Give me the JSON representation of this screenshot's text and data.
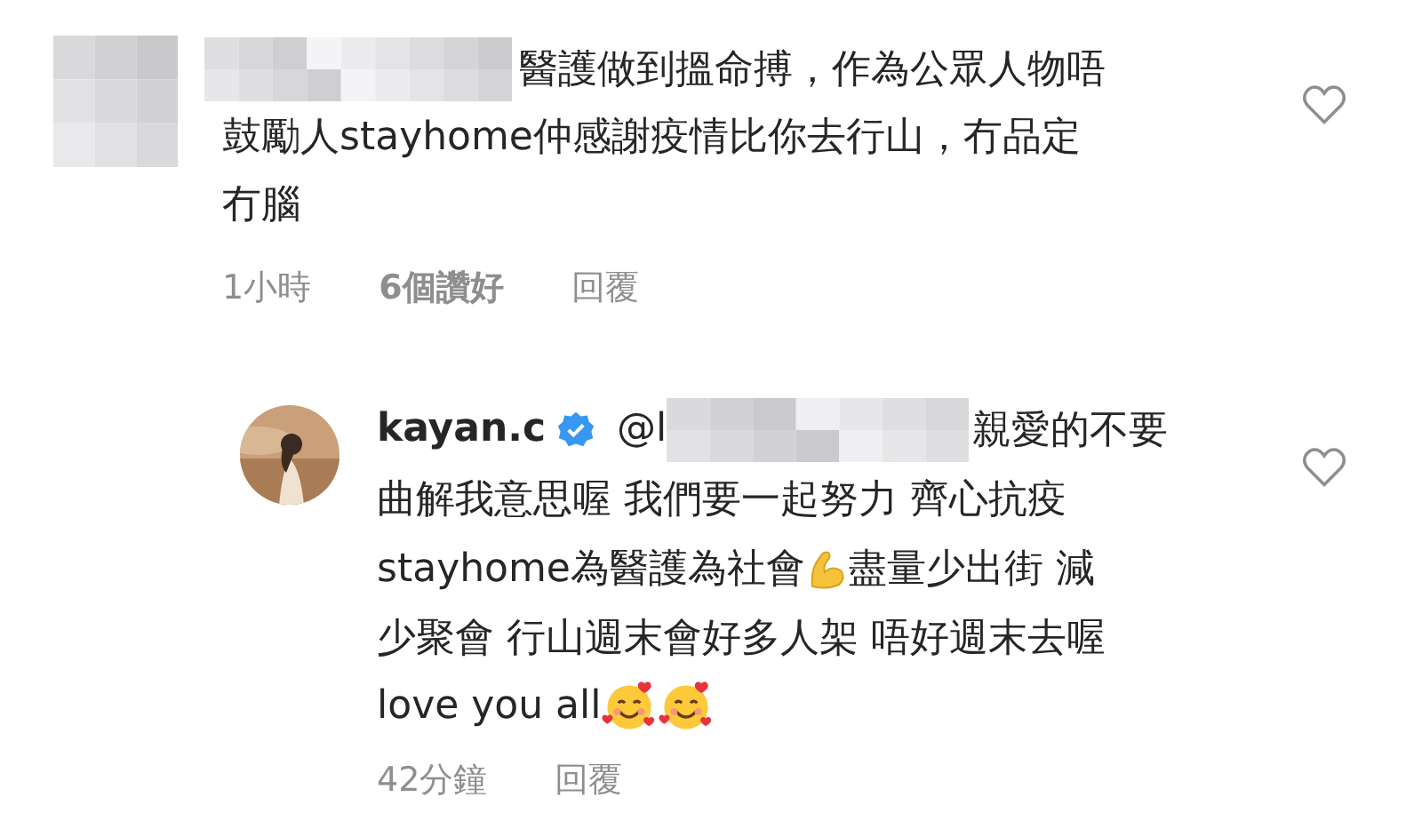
{
  "comments": [
    {
      "is_reply": false,
      "avatar": {
        "kind": "blurred"
      },
      "username": {
        "kind": "blurred"
      },
      "liked": false,
      "lines": [
        [
          {
            "kind": "text",
            "text": "醫護做到搵命搏，作為公眾人物唔"
          }
        ],
        [
          {
            "kind": "text",
            "text": "鼓勵人stayhome仲感謝疫情比你去行山，冇品定"
          }
        ],
        [
          {
            "kind": "text",
            "text": "冇腦"
          }
        ]
      ],
      "time": "1小時",
      "likes": "6個讚好",
      "reply": "回覆"
    },
    {
      "is_reply": true,
      "avatar": {
        "kind": "picture"
      },
      "username": {
        "kind": "text",
        "text": "kayan.c",
        "verified": true
      },
      "liked": false,
      "lines": [
        [
          {
            "kind": "text",
            "text": "@l"
          },
          {
            "kind": "blur"
          },
          {
            "kind": "text",
            "text": "親愛的不要"
          }
        ],
        [
          {
            "kind": "text",
            "text": "曲解我意思喔 我們要一起努力 齊心抗疫"
          }
        ],
        [
          {
            "kind": "text",
            "text": "stayhome為醫護為社會"
          },
          {
            "kind": "flexed-arm"
          },
          {
            "kind": "text",
            "text": " 盡量少出街 減"
          }
        ],
        [
          {
            "kind": "text",
            "text": "少聚會 行山週末會好多人架 唔好週末去喔"
          }
        ],
        [
          {
            "kind": "text",
            "text": "love you all"
          },
          {
            "kind": "heart-face"
          },
          {
            "kind": "heart-face"
          }
        ]
      ],
      "time": "42分鐘",
      "reply": "回覆"
    }
  ]
}
